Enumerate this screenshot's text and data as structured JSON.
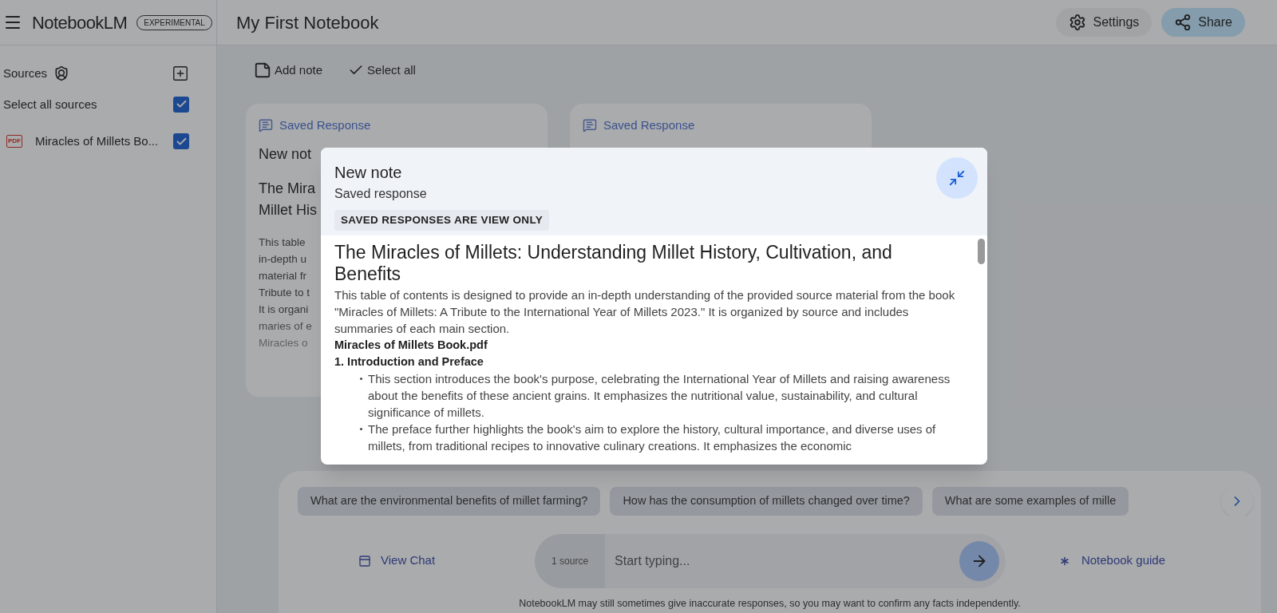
{
  "app": {
    "name": "NotebookLM",
    "badge": "EXPERIMENTAL"
  },
  "notebook_title": "My First Notebook",
  "header_buttons": [
    {
      "label": "Settings",
      "kind": "settings"
    },
    {
      "label": "Share",
      "kind": "share"
    }
  ],
  "sources": {
    "title": "Sources",
    "select_all": {
      "label": "Select all sources",
      "checked": true
    },
    "items": [
      {
        "label": "Miracles of Millets Bo...",
        "type": "PDF",
        "checked": true
      }
    ]
  },
  "toolbar": [
    {
      "label": "Add note",
      "kind": "add"
    },
    {
      "label": "Select all",
      "kind": "select"
    }
  ],
  "notes": [
    {
      "label": "Saved Response",
      "title": "New not",
      "heading": [
        "The Mira",
        "Millet His"
      ],
      "body": [
        "This table",
        "in-depth u",
        "material fr",
        "Tribute to t",
        "It is organi",
        "maries of e",
        "Miracles o"
      ]
    },
    {
      "label": "Saved Response"
    }
  ],
  "modal": {
    "title": "New note",
    "subtitle": "Saved response",
    "notice": "SAVED RESPONSES ARE VIEW ONLY",
    "heading": "The Miracles of Millets: Understanding Millet History, Cultivation, and Benefits",
    "intro": "This table of contents is designed to provide an in-depth understanding of the provided source material from the book \"Miracles of Millets: A Tribute to the International Year of Millets 2023.\" It is organized by source and includes summaries of each main section.",
    "source": "Miracles of Millets Book.pdf",
    "section": "1. Introduction and Preface",
    "bullets": [
      "This section introduces the book's purpose, celebrating the International Year of Millets and raising awareness about the benefits of these ancient grains. It emphasizes the nutritional value, sustainability, and cultural significance of millets.",
      "The preface further highlights the book's aim to explore the history, cultural importance, and diverse uses of millets, from traditional recipes to innovative culinary creations. It emphasizes the economic"
    ]
  },
  "chat": {
    "suggestions": [
      "What are the environmental benefits of millet farming?",
      "How has the consumption of millets changed over time?",
      "What are some examples of mille"
    ],
    "view_chat": "View Chat",
    "source_count": "1 source",
    "input": {
      "placeholder": "Start typing..."
    },
    "guide": "Notebook guide",
    "disclaimer": "NotebookLM may still sometimes give inaccurate responses, so you may want to confirm any facts independently."
  }
}
